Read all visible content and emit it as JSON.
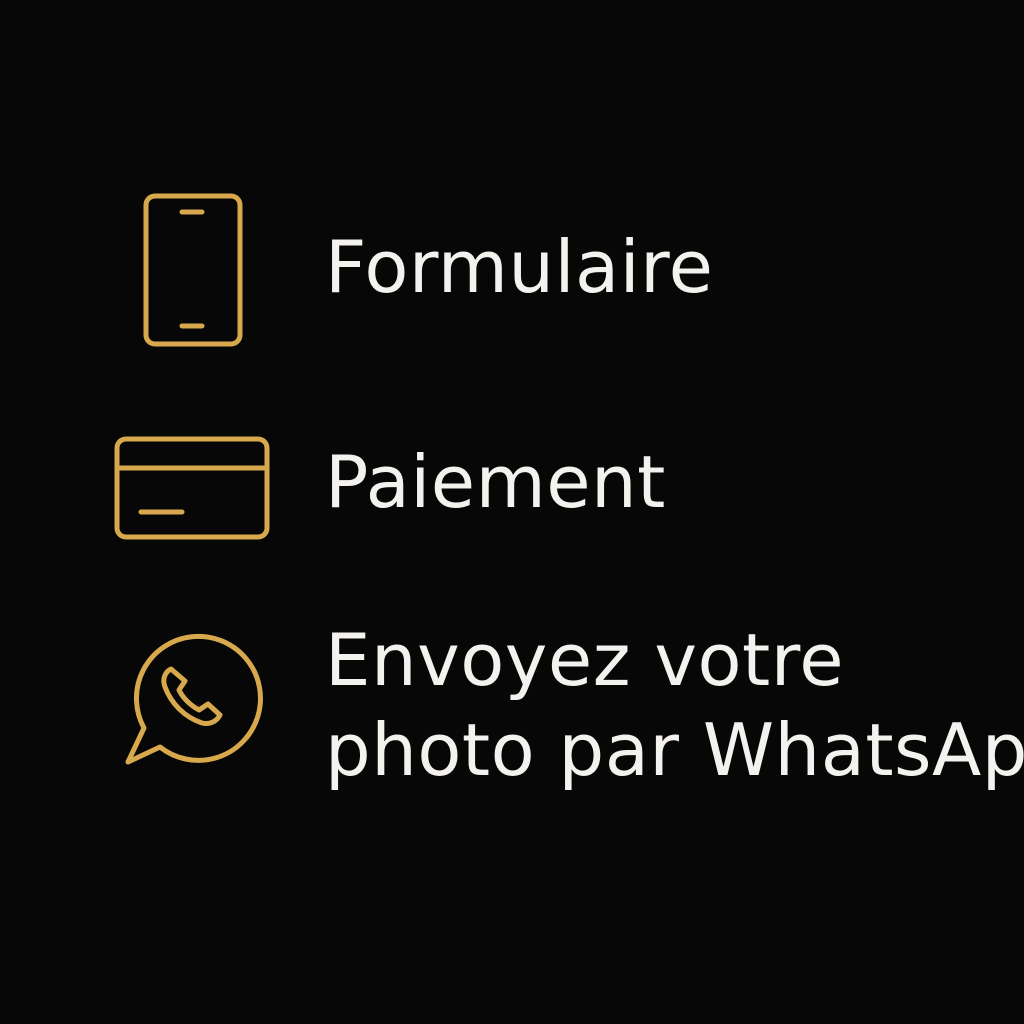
{
  "colors": {
    "background": "#070707",
    "icon_gold": "#d8a84c",
    "text": "#f4f2ee"
  },
  "steps": [
    {
      "icon": "smartphone-icon",
      "label": "Formulaire"
    },
    {
      "icon": "credit-card-icon",
      "label": "Paiement"
    },
    {
      "icon": "whatsapp-icon",
      "label": "Envoyez votre\nphoto par WhatsApp"
    }
  ]
}
